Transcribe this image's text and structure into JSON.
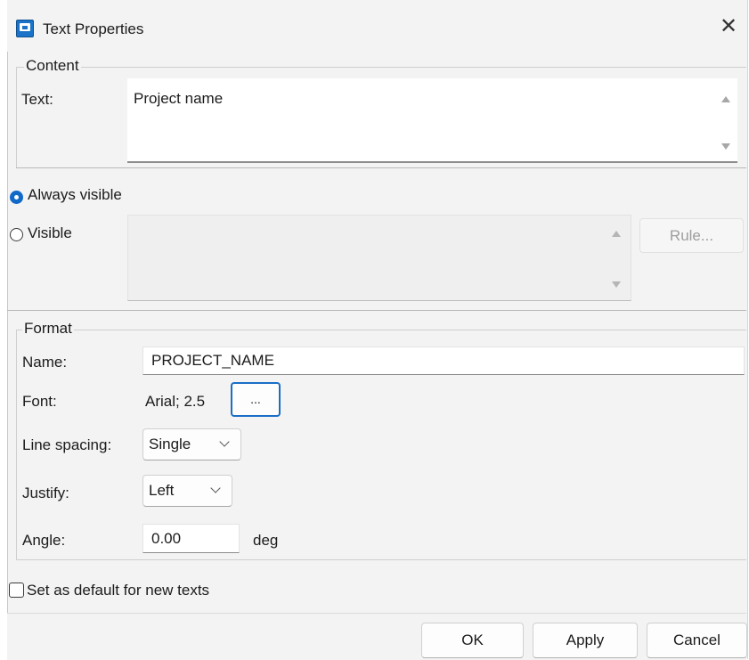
{
  "window": {
    "title": "Text Properties",
    "close_glyph": "✕"
  },
  "content_group": {
    "title": "Content",
    "text_label": "Text:",
    "text_value": "Project name"
  },
  "visibility": {
    "always_visible_label": "Always visible",
    "always_visible_selected": true,
    "visible_label": "Visible",
    "visible_selected": false,
    "rule_button": "Rule..."
  },
  "format_group": {
    "title": "Format",
    "name_label": "Name:",
    "name_value": "PROJECT_NAME",
    "font_label": "Font:",
    "font_value": "Arial; 2.5",
    "font_button": "...",
    "line_spacing_label": "Line spacing:",
    "line_spacing_value": "Single",
    "justify_label": "Justify:",
    "justify_value": "Left",
    "angle_label": "Angle:",
    "angle_value": "0.00",
    "angle_unit": "deg"
  },
  "default_checkbox": {
    "label": "Set as default for new texts",
    "checked": false
  },
  "buttons": {
    "ok": "OK",
    "apply": "Apply",
    "cancel": "Cancel"
  },
  "colors": {
    "accent": "#1169c8",
    "dialog_bg": "#f3f3f3",
    "disabled_text": "#9e9e9e"
  },
  "icons": {
    "app": "app-window-icon",
    "close": "close-icon",
    "scroll_up": "scroll-up-arrow-icon",
    "scroll_down": "scroll-down-arrow-icon",
    "dropdown": "chevron-down-icon"
  }
}
